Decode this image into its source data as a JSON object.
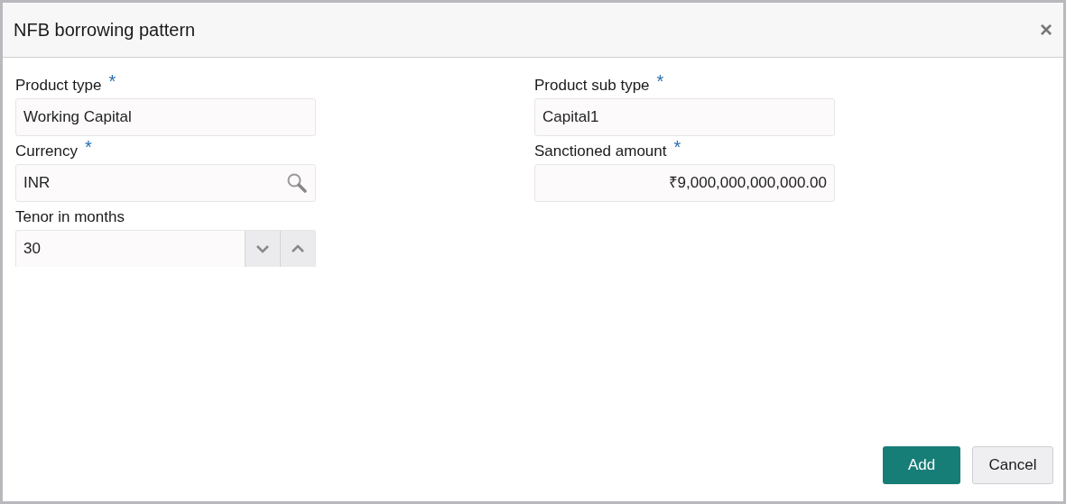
{
  "dialog": {
    "title": "NFB borrowing pattern",
    "close": "×"
  },
  "rows": [
    [
      {
        "kind": "text",
        "label": "Product type",
        "required_mark": "*",
        "value": "Working Capital"
      },
      {
        "kind": "text",
        "label": "Product sub type",
        "required_mark": "*",
        "value": "Capital1"
      }
    ],
    [
      {
        "kind": "lookup",
        "label": "Currency",
        "required_mark": "*",
        "value": "INR"
      },
      {
        "kind": "amount",
        "label": "Sanctioned amount",
        "required_mark": "*",
        "value": "₹9,000,000,000,000.00"
      }
    ],
    [
      {
        "kind": "stepper",
        "label": "Tenor in months",
        "value": "30"
      }
    ]
  ],
  "buttons": [
    {
      "label": "Add",
      "kind": "primary"
    },
    {
      "label": "Cancel",
      "kind": "secondary"
    }
  ]
}
